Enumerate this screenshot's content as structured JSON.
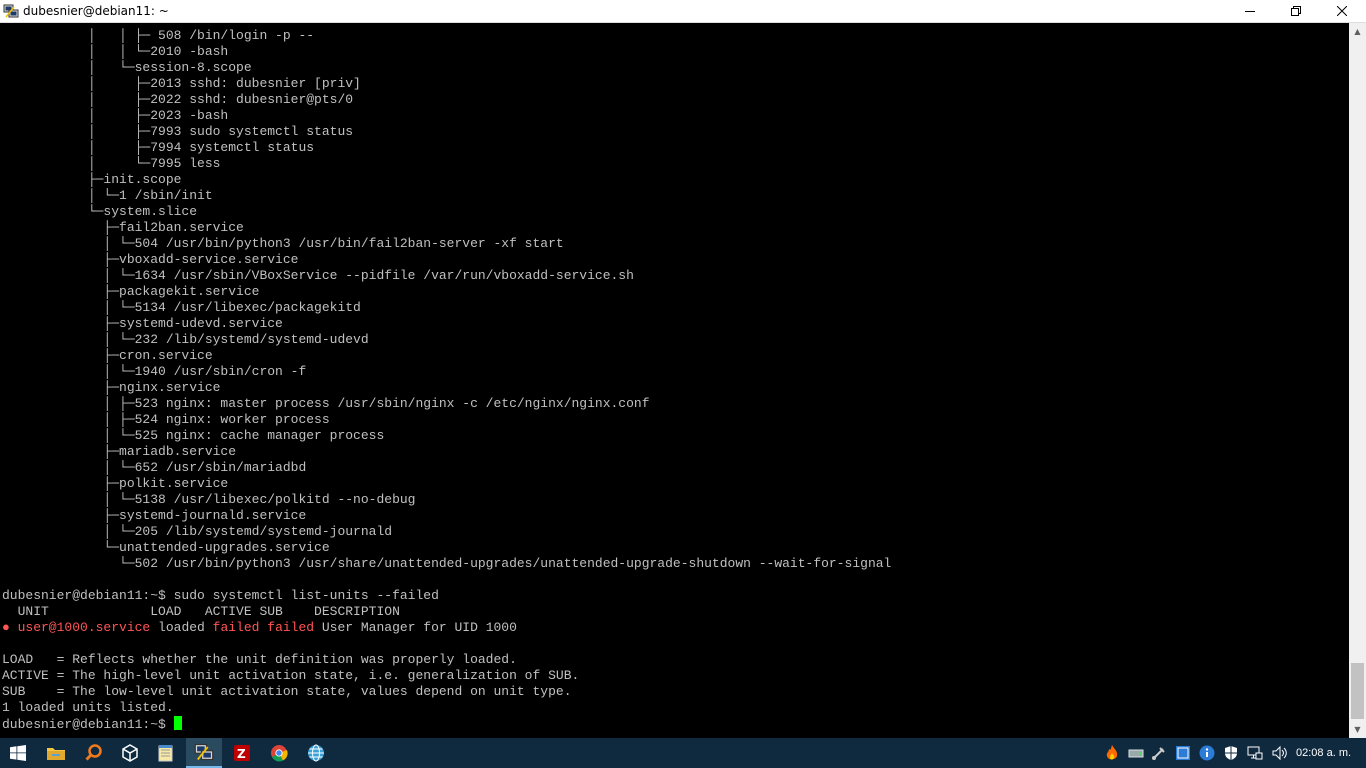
{
  "window": {
    "title": "dubesnier@debian11: ~"
  },
  "terminal": {
    "lines": [
      [
        {
          "t": "           │   │ ├─ 508 /bin/login -p --"
        }
      ],
      [
        {
          "t": "           │   │ └─2010 -bash"
        }
      ],
      [
        {
          "t": "           │   └─session-8.scope"
        }
      ],
      [
        {
          "t": "           │     ├─2013 sshd: dubesnier [priv]"
        }
      ],
      [
        {
          "t": "           │     ├─2022 sshd: dubesnier@pts/0"
        }
      ],
      [
        {
          "t": "           │     ├─2023 -bash"
        }
      ],
      [
        {
          "t": "           │     ├─7993 sudo systemctl status"
        }
      ],
      [
        {
          "t": "           │     ├─7994 systemctl status"
        }
      ],
      [
        {
          "t": "           │     └─7995 less"
        }
      ],
      [
        {
          "t": "           ├─init.scope"
        }
      ],
      [
        {
          "t": "           │ └─1 /sbin/init"
        }
      ],
      [
        {
          "t": "           └─system.slice"
        }
      ],
      [
        {
          "t": "             ├─fail2ban.service"
        }
      ],
      [
        {
          "t": "             │ └─504 /usr/bin/python3 /usr/bin/fail2ban-server -xf start"
        }
      ],
      [
        {
          "t": "             ├─vboxadd-service.service"
        }
      ],
      [
        {
          "t": "             │ └─1634 /usr/sbin/VBoxService --pidfile /var/run/vboxadd-service.sh"
        }
      ],
      [
        {
          "t": "             ├─packagekit.service"
        }
      ],
      [
        {
          "t": "             │ └─5134 /usr/libexec/packagekitd"
        }
      ],
      [
        {
          "t": "             ├─systemd-udevd.service"
        }
      ],
      [
        {
          "t": "             │ └─232 /lib/systemd/systemd-udevd"
        }
      ],
      [
        {
          "t": "             ├─cron.service"
        }
      ],
      [
        {
          "t": "             │ └─1940 /usr/sbin/cron -f"
        }
      ],
      [
        {
          "t": "             ├─nginx.service"
        }
      ],
      [
        {
          "t": "             │ ├─523 nginx: master process /usr/sbin/nginx -c /etc/nginx/nginx.conf"
        }
      ],
      [
        {
          "t": "             │ ├─524 nginx: worker process"
        }
      ],
      [
        {
          "t": "             │ └─525 nginx: cache manager process"
        }
      ],
      [
        {
          "t": "             ├─mariadb.service"
        }
      ],
      [
        {
          "t": "             │ └─652 /usr/sbin/mariadbd"
        }
      ],
      [
        {
          "t": "             ├─polkit.service"
        }
      ],
      [
        {
          "t": "             │ └─5138 /usr/libexec/polkitd --no-debug"
        }
      ],
      [
        {
          "t": "             ├─systemd-journald.service"
        }
      ],
      [
        {
          "t": "             │ └─205 /lib/systemd/systemd-journald"
        }
      ],
      [
        {
          "t": "             └─unattended-upgrades.service"
        }
      ],
      [
        {
          "t": "               └─502 /usr/bin/python3 /usr/share/unattended-upgrades/unattended-upgrade-shutdown --wait-for-signal"
        }
      ],
      [
        {
          "t": ""
        }
      ],
      [
        {
          "t": "dubesnier@debian11:~$ sudo systemctl list-units --failed"
        }
      ],
      [
        {
          "t": "  UNIT             LOAD   ACTIVE SUB    DESCRIPTION"
        }
      ],
      [
        {
          "t": "● user@1000.service",
          "c": "red"
        },
        {
          "t": " loaded "
        },
        {
          "t": "failed failed",
          "c": "red"
        },
        {
          "t": " User Manager for UID 1000"
        }
      ],
      [
        {
          "t": ""
        }
      ],
      [
        {
          "t": "LOAD   = Reflects whether the unit definition was properly loaded."
        }
      ],
      [
        {
          "t": "ACTIVE = The high-level unit activation state, i.e. generalization of SUB."
        }
      ],
      [
        {
          "t": "SUB    = The low-level unit activation state, values depend on unit type."
        }
      ],
      [
        {
          "t": "1 loaded units listed."
        }
      ],
      [
        {
          "t": "dubesnier@debian11:~$ "
        },
        {
          "cursor": true
        }
      ]
    ]
  },
  "taskbar": {
    "clock": "02:08 a. m.",
    "colors": {
      "background": "#0f2a3f",
      "accent": "#76b9ed"
    }
  },
  "colors": {
    "terminal_fg": "#c0c0c0",
    "failed": "#ff5555",
    "cursor": "#00ff00"
  }
}
